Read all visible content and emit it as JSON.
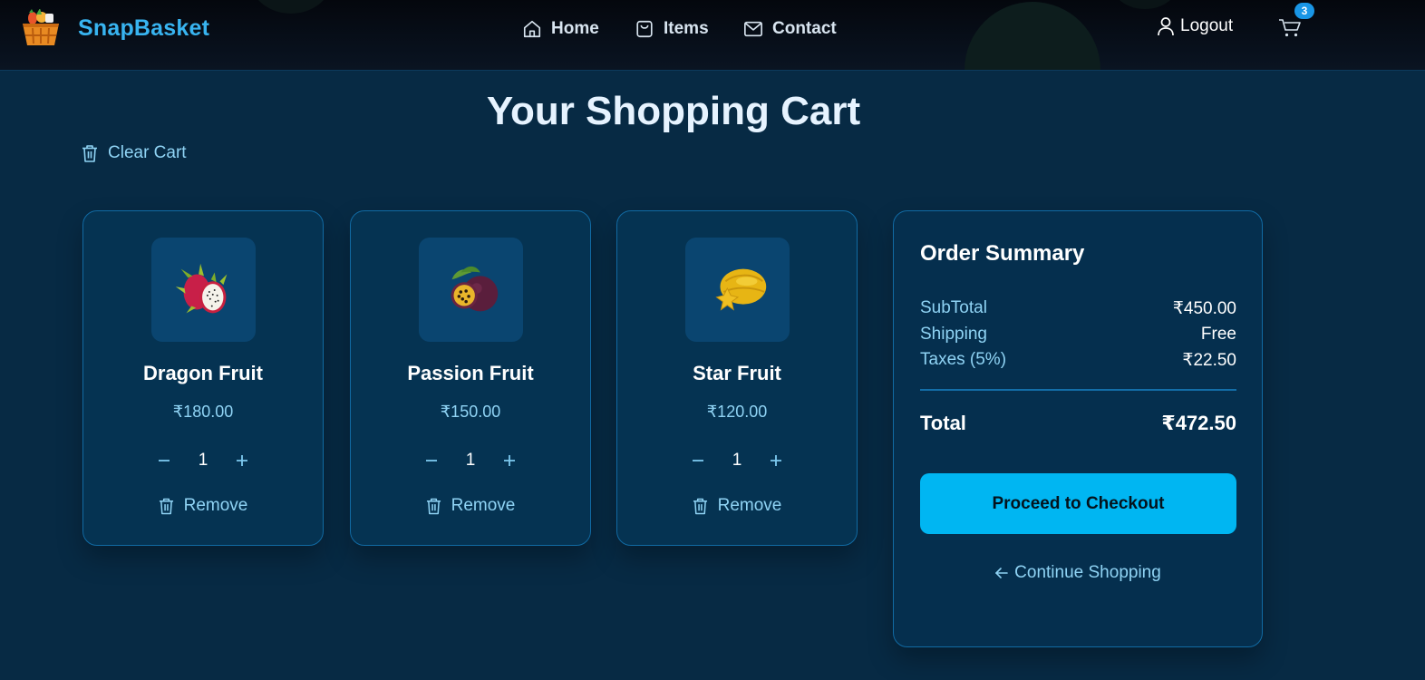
{
  "brand": {
    "name": "SnapBasket",
    "logo_icon": "basket-logo"
  },
  "nav": {
    "links": [
      {
        "label": "Home",
        "icon": "home-icon"
      },
      {
        "label": "Items",
        "icon": "bag-icon"
      },
      {
        "label": "Contact",
        "icon": "mail-icon"
      }
    ],
    "logout_label": "Logout",
    "cart_count": "3"
  },
  "page": {
    "title": "Your Shopping Cart",
    "clear_cart_label": "Clear Cart"
  },
  "cart_items": [
    {
      "name": "Dragon Fruit",
      "price": "₹180.00",
      "quantity": "1",
      "remove_label": "Remove",
      "image": "dragon-fruit"
    },
    {
      "name": "Passion Fruit",
      "price": "₹150.00",
      "quantity": "1",
      "remove_label": "Remove",
      "image": "passion-fruit"
    },
    {
      "name": "Star Fruit",
      "price": "₹120.00",
      "quantity": "1",
      "remove_label": "Remove",
      "image": "star-fruit"
    }
  ],
  "summary": {
    "heading": "Order Summary",
    "subtotal_label": "SubTotal",
    "subtotal_value": "₹450.00",
    "shipping_label": "Shipping",
    "shipping_value": "Free",
    "taxes_label": "Taxes (5%)",
    "taxes_value": "₹22.50",
    "total_label": "Total",
    "total_value": "₹472.50",
    "checkout_label": "Proceed to Checkout",
    "continue_label": "Continue Shopping"
  },
  "colors": {
    "background": "#072a44",
    "accent": "#00b6f2",
    "brand": "#38b4f0",
    "muted_text": "#8fd3f4",
    "card_border": "#116aa3"
  }
}
